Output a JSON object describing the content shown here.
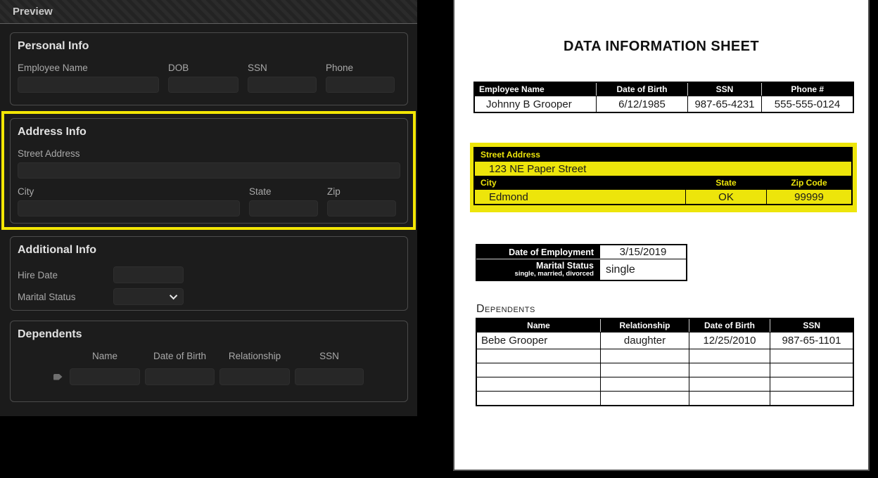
{
  "colors": {
    "highlight_yellow": "#f3e604",
    "doc_highlight_yellow": "#ede50b",
    "panel_bg": "#1b1b1b"
  },
  "preview": {
    "title": "Preview",
    "personal": {
      "title": "Personal Info",
      "fields": [
        "Employee Name",
        "DOB",
        "SSN",
        "Phone"
      ]
    },
    "address": {
      "title": "Address Info",
      "fields": [
        "Street Address",
        "City",
        "State",
        "Zip"
      ]
    },
    "additional": {
      "title": "Additional Info",
      "fields": [
        "Hire Date",
        "Marital Status"
      ]
    },
    "dependents": {
      "title": "Dependents",
      "columns": [
        "Name",
        "Date of Birth",
        "Relationship",
        "SSN"
      ]
    }
  },
  "document": {
    "title": "DATA INFORMATION SHEET",
    "employee_table": {
      "headers": [
        "Employee Name",
        "Date of Birth",
        "SSN",
        "Phone #"
      ],
      "row": [
        "Johnny B Grooper",
        "6/12/1985",
        "987-65-4231",
        "555-555-0124"
      ]
    },
    "address_block": {
      "street_header": "Street Address",
      "street_value": "123 NE Paper Street",
      "headers": [
        "City",
        "State",
        "Zip Code"
      ],
      "values": [
        "Edmond",
        "OK",
        "99999"
      ]
    },
    "employment_table": {
      "rows": [
        {
          "label": "Date of Employment",
          "value": "3/15/2019"
        },
        {
          "label": "Marital Status",
          "sub": "single, married, divorced",
          "value": "single"
        }
      ]
    },
    "dependents": {
      "heading": "Dependents",
      "headers": [
        "Name",
        "Relationship",
        "Date of Birth",
        "SSN"
      ],
      "rows": [
        [
          "Bebe Grooper",
          "daughter",
          "12/25/2010",
          "987-65-1101"
        ]
      ],
      "empty_row_count": 4
    }
  }
}
